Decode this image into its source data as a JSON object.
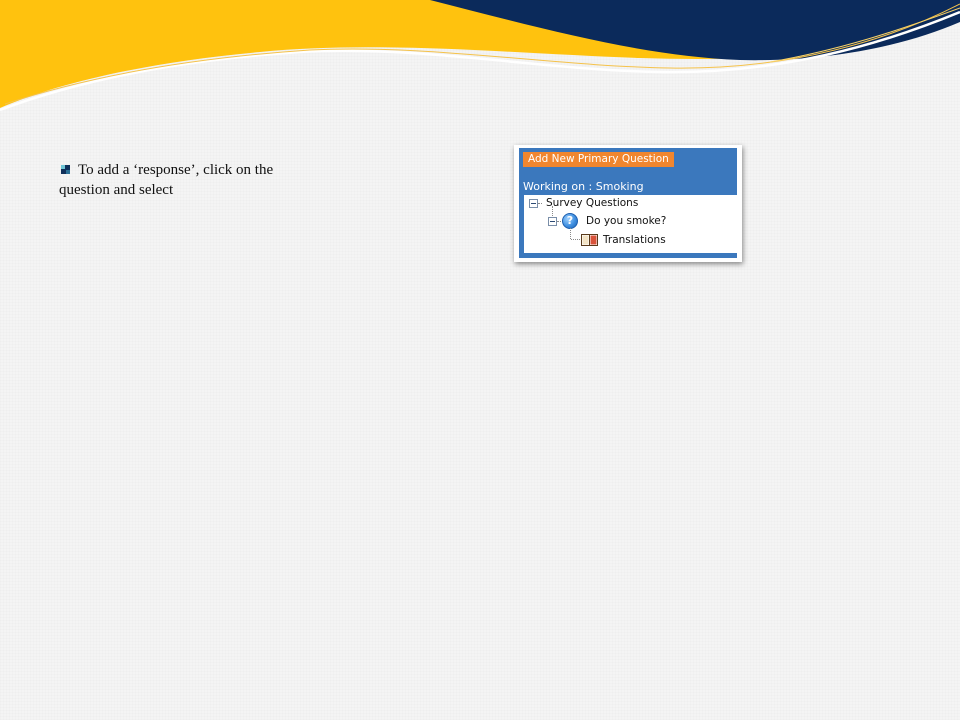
{
  "slide": {
    "bullet_text": "To add a ‘response’, click on the question and select"
  },
  "panel": {
    "add_button_label": "Add New Primary Question",
    "working_on_label": "Working on : Smoking",
    "tree": {
      "root_label": "Survey Questions",
      "question_label": "Do you smoke?",
      "child_label": "Translations"
    }
  },
  "colors": {
    "banner_yellow": "#ffc20e",
    "banner_navy": "#0b2a5b",
    "panel_blue": "#3b78bd",
    "button_orange": "#f0862f"
  },
  "icons": [
    "bullet-icon",
    "collapse-icon",
    "question-icon",
    "book-icon"
  ]
}
